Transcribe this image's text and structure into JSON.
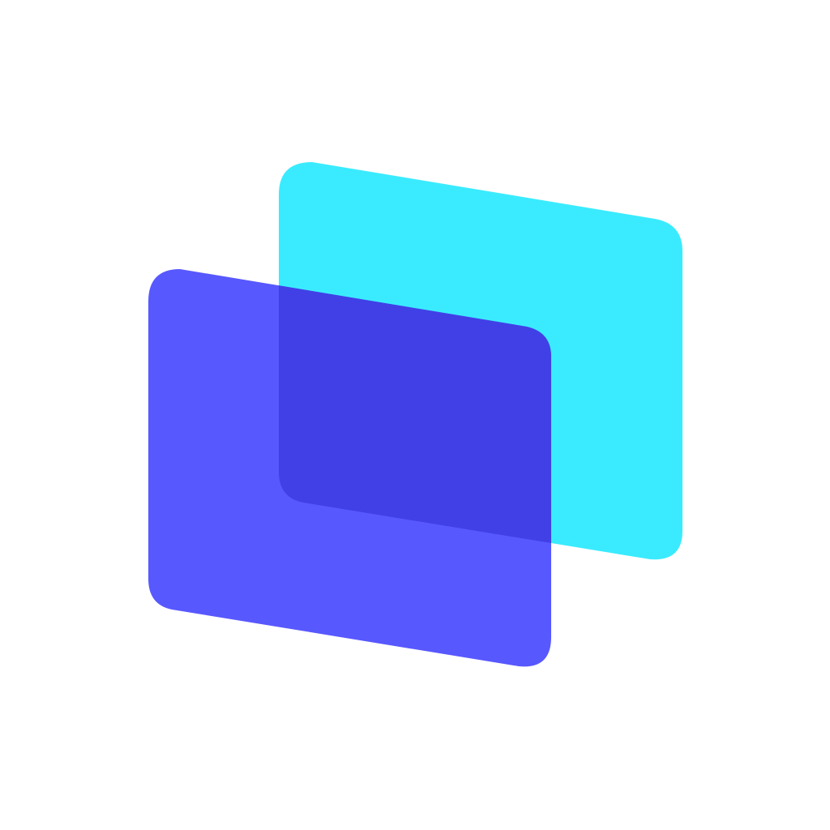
{
  "logo": {
    "name": "layered-panels-logo",
    "colors": {
      "background": "#ffffff",
      "back_panel": "#3AEBFF",
      "front_panel": "#5858FF",
      "overlap": "#4140E6"
    },
    "icon": "two-overlapping-skewed-panels-icon"
  }
}
